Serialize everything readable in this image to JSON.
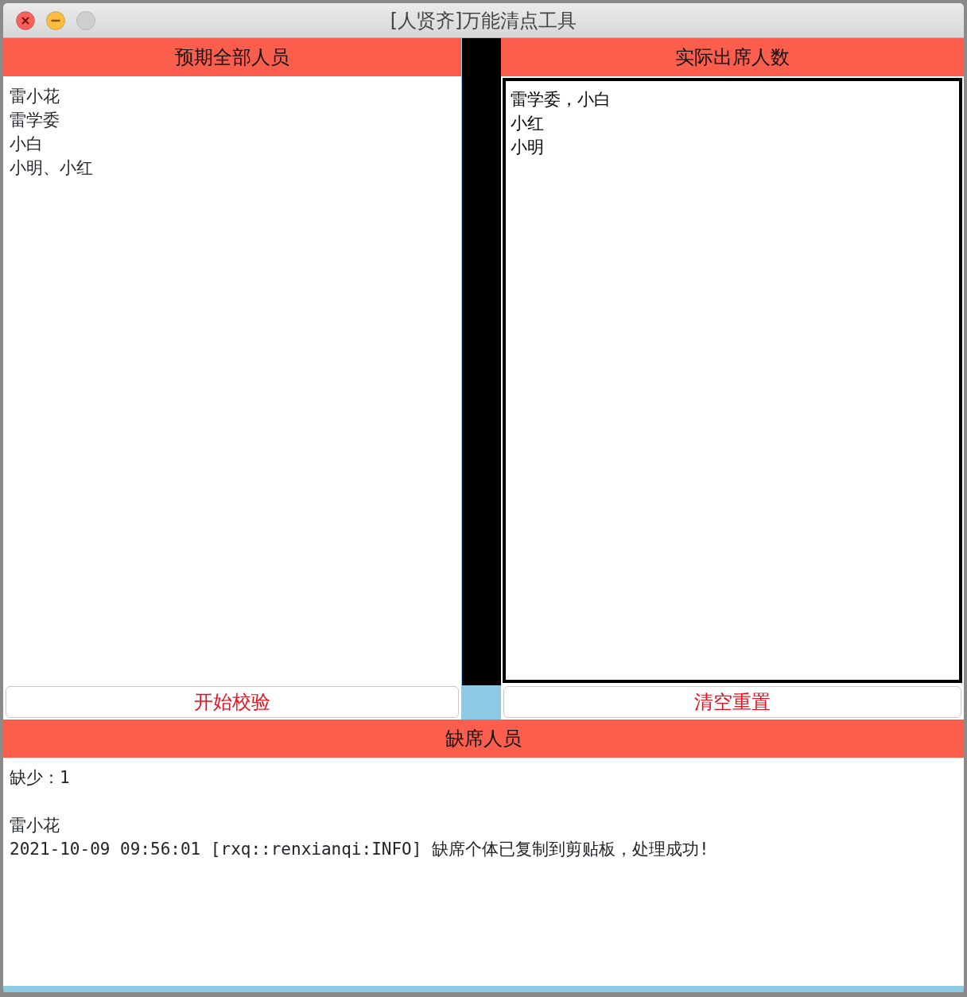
{
  "window": {
    "title": "[人贤齐]万能清点工具",
    "controls": [
      {
        "kind": "close",
        "disabled": false
      },
      {
        "kind": "minimize",
        "disabled": false
      },
      {
        "kind": "zoom",
        "disabled": true
      }
    ]
  },
  "expected": {
    "heading": "预期全部人员",
    "lines": [
      "雷小花",
      "雷学委",
      "小白",
      "小明、小红"
    ]
  },
  "actual": {
    "heading": "实际出席人数",
    "focused": true,
    "value_lines": [
      "雷学委，小白",
      "小红",
      "小明"
    ]
  },
  "buttons": [
    {
      "label": "开始校验"
    },
    {
      "label": "清空重置"
    }
  ],
  "absent": {
    "heading": "缺席人员",
    "blocks": [
      {
        "lines": [
          "缺少：1"
        ]
      },
      {
        "lines": [
          "雷小花",
          "2021-10-09 09:56:01 [rxq::renxianqi:INFO] 缺席个体已复制到剪贴板，处理成功!"
        ]
      }
    ]
  }
}
